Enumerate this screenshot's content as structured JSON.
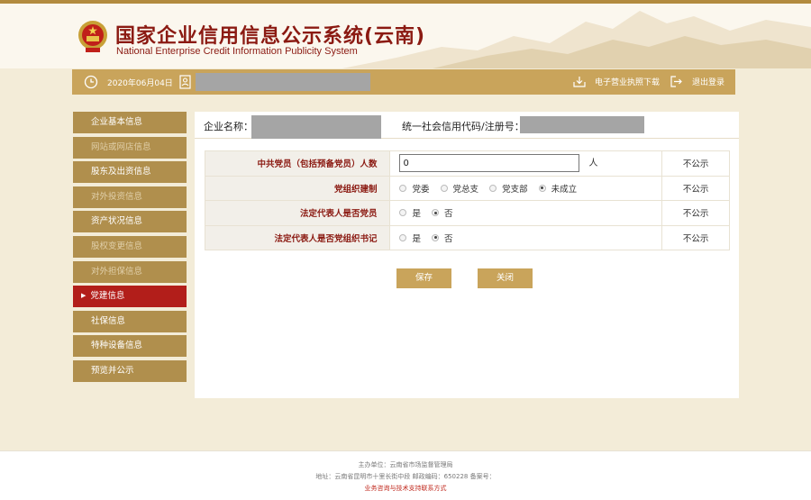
{
  "header": {
    "title_cn": "国家企业信用信息公示系统(云南)",
    "title_en": "National Enterprise Credit Information Publicity System"
  },
  "toolbar": {
    "date": "2020年06月04日",
    "download_label": "电子营业执照下载",
    "logout_label": "退出登录"
  },
  "sidebar": {
    "items": [
      {
        "label": "企业基本信息"
      },
      {
        "label": "网站或网店信息"
      },
      {
        "label": "股东及出资信息"
      },
      {
        "label": "对外投资信息"
      },
      {
        "label": "资产状况信息"
      },
      {
        "label": "股权变更信息"
      },
      {
        "label": "对外担保信息"
      },
      {
        "label": "党建信息"
      },
      {
        "label": "社保信息"
      },
      {
        "label": "特种设备信息"
      },
      {
        "label": "预览并公示"
      }
    ],
    "active_index": 7
  },
  "main": {
    "company_name_label": "企业名称：",
    "credit_code_label": "统一社会信用代码/注册号：",
    "form": {
      "rows": [
        {
          "label": "中共党员（包括预备党员）人数",
          "value": "0",
          "unit": "人",
          "publicity": "不公示"
        },
        {
          "label": "党组织建制",
          "options": [
            "党委",
            "党总支",
            "党支部",
            "未成立"
          ],
          "selected": "未成立",
          "publicity": "不公示"
        },
        {
          "label": "法定代表人是否党员",
          "options": [
            "是",
            "否"
          ],
          "selected": "否",
          "publicity": "不公示"
        },
        {
          "label": "法定代表人是否党组织书记",
          "options": [
            "是",
            "否"
          ],
          "selected": "否",
          "publicity": "不公示"
        }
      ]
    },
    "buttons": {
      "save": "保存",
      "close": "关闭"
    }
  },
  "footer": {
    "line1": "主办单位：云南省市场监督管理局",
    "line2": "地址：云南省昆明市十里长街中段 邮政编码：650228 备案号：",
    "line3": "业务咨询与技术支持联系方式"
  },
  "colors": {
    "gold": "#c9a45b",
    "sidebar": "#b08f4d",
    "active": "#b21e1a",
    "brand_red": "#8b1a12"
  },
  "icons": [
    "emblem-icon",
    "clock-icon",
    "user-icon",
    "download-icon",
    "logout-icon"
  ]
}
